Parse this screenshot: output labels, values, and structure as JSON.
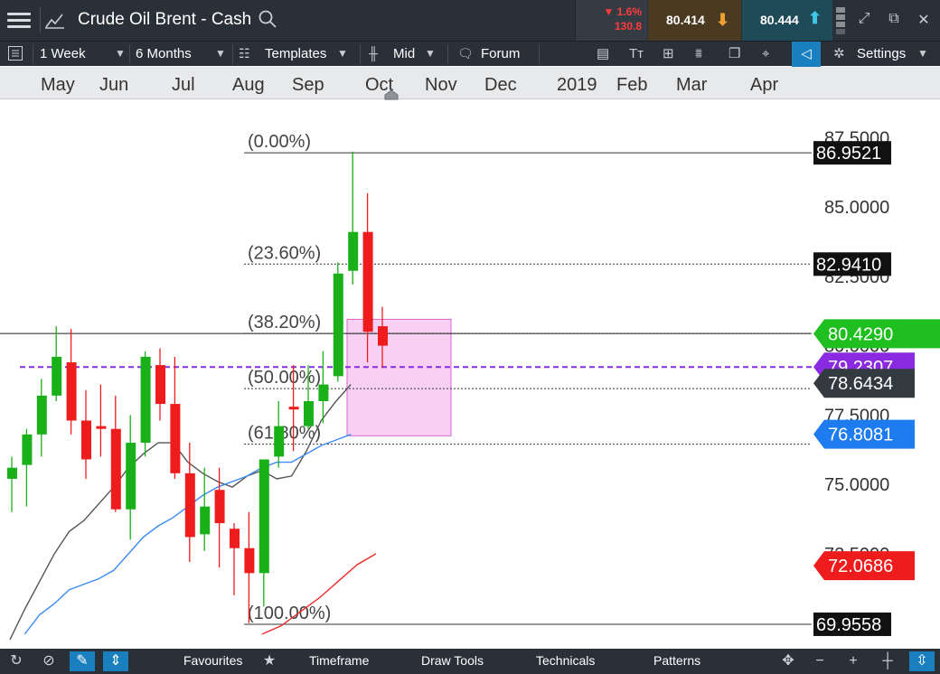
{
  "header": {
    "title": "Crude Oil Brent - Cash",
    "change_pct": "▼ 1.6%",
    "change_pts": "130.8",
    "bid": "80.414",
    "ask": "80.444"
  },
  "toolbar": {
    "interval": "1 Week",
    "range": "6 Months",
    "templates": "Templates",
    "price_type": "Mid",
    "forum": "Forum",
    "settings": "Settings"
  },
  "time_axis": {
    "months": [
      "May",
      "Jun",
      "Jul",
      "Aug",
      "Sep",
      "Oct",
      "Nov",
      "Dec",
      "2019",
      "Feb",
      "Mar",
      "Apr"
    ]
  },
  "bottom_bar": {
    "favourites": "Favourites",
    "timeframe": "Timeframe",
    "draw_tools": "Draw Tools",
    "technicals": "Technicals",
    "patterns": "Patterns"
  },
  "colors": {
    "up": "#19b019",
    "down": "#ee1c1c",
    "ma_short": "#555555",
    "ma_mid": "#3a8cf0",
    "ma_long": "#ee2b2b",
    "fib_box": "#f7c8f2",
    "current_price": "#1fbf1f",
    "dashed_line": "#8a2be2"
  },
  "chart_data": {
    "type": "candlestick",
    "y_ticks": [
      "87.5000",
      "85.0000",
      "82.5000",
      "80.0000",
      "77.5000",
      "75.0000",
      "72.5000"
    ],
    "ylim": [
      69.3,
      88.5
    ],
    "fib_levels": [
      {
        "label": "(0.00%)",
        "value": 86.9521,
        "tag": "86.9521"
      },
      {
        "label": "(23.60%)",
        "value": 82.941,
        "tag": "82.9410"
      },
      {
        "label": "(38.20%)",
        "value": 80.44,
        "tag": ""
      },
      {
        "label": "(50.00%)",
        "value": 78.45,
        "tag": ""
      },
      {
        "label": "(61.80%)",
        "value": 76.45,
        "tag": ""
      },
      {
        "label": "(100.00%)",
        "value": 69.9558,
        "tag": "69.9558"
      }
    ],
    "price_tags": [
      {
        "value": 80.429,
        "text": "80.4290",
        "color": "#1fbf1f"
      },
      {
        "value": 79.2307,
        "text": "79.2307",
        "color": "#8a2be2"
      },
      {
        "value": 78.6434,
        "text": "78.6434",
        "color": "#333a40"
      },
      {
        "value": 76.8081,
        "text": "76.8081",
        "color": "#1e7cf0"
      },
      {
        "value": 72.0686,
        "text": "72.0686",
        "color": "#ee1c1c"
      }
    ],
    "candles": [
      {
        "o": 75.2,
        "h": 76.0,
        "l": 74.0,
        "c": 75.6
      },
      {
        "o": 75.7,
        "h": 77.0,
        "l": 74.2,
        "c": 76.8
      },
      {
        "o": 76.8,
        "h": 78.8,
        "l": 76.0,
        "c": 78.2
      },
      {
        "o": 78.2,
        "h": 80.7,
        "l": 78.0,
        "c": 79.6
      },
      {
        "o": 79.4,
        "h": 80.6,
        "l": 76.8,
        "c": 77.3
      },
      {
        "o": 77.3,
        "h": 78.4,
        "l": 75.2,
        "c": 75.9
      },
      {
        "o": 77.1,
        "h": 78.6,
        "l": 76.0,
        "c": 77.0
      },
      {
        "o": 77.0,
        "h": 78.2,
        "l": 74.0,
        "c": 74.1
      },
      {
        "o": 74.1,
        "h": 77.5,
        "l": 73.0,
        "c": 76.5
      },
      {
        "o": 76.5,
        "h": 79.8,
        "l": 76.0,
        "c": 79.6
      },
      {
        "o": 79.3,
        "h": 79.9,
        "l": 77.3,
        "c": 77.9
      },
      {
        "o": 77.9,
        "h": 79.6,
        "l": 75.2,
        "c": 75.4
      },
      {
        "o": 75.4,
        "h": 76.5,
        "l": 72.2,
        "c": 73.1
      },
      {
        "o": 73.2,
        "h": 75.6,
        "l": 72.6,
        "c": 74.2
      },
      {
        "o": 74.8,
        "h": 75.6,
        "l": 72.0,
        "c": 73.6
      },
      {
        "o": 73.4,
        "h": 73.6,
        "l": 71.0,
        "c": 72.7
      },
      {
        "o": 72.7,
        "h": 74.0,
        "l": 70.0,
        "c": 71.8
      },
      {
        "o": 71.8,
        "h": 75.9,
        "l": 70.6,
        "c": 75.9
      },
      {
        "o": 76.0,
        "h": 78.0,
        "l": 75.6,
        "c": 77.1
      },
      {
        "o": 77.8,
        "h": 79.3,
        "l": 76.2,
        "c": 77.7
      },
      {
        "o": 77.1,
        "h": 79.3,
        "l": 77.0,
        "c": 78.0
      },
      {
        "o": 78.0,
        "h": 79.8,
        "l": 77.2,
        "c": 78.6
      },
      {
        "o": 78.9,
        "h": 83.0,
        "l": 78.7,
        "c": 82.6
      },
      {
        "o": 82.7,
        "h": 87.0,
        "l": 82.2,
        "c": 84.1
      },
      {
        "o": 84.1,
        "h": 85.5,
        "l": 79.4,
        "c": 80.5
      },
      {
        "o": 80.7,
        "h": 81.4,
        "l": 79.2,
        "c": 80.0
      }
    ],
    "ma_short": [
      69.4,
      70.5,
      71.5,
      72.5,
      73.3,
      73.7,
      74.3,
      74.9,
      75.6,
      76.1,
      76.5,
      76.5,
      75.8,
      75.4,
      75.1,
      74.9,
      75.3,
      75.5,
      75.2,
      75.3,
      76.2,
      77.3,
      78.0,
      78.6
    ],
    "ma_mid": [
      69.6,
      70.3,
      70.7,
      71.2,
      71.4,
      71.6,
      71.9,
      72.5,
      73.1,
      73.5,
      73.8,
      74.2,
      74.6,
      74.9,
      75.1,
      75.3,
      75.6,
      75.8,
      75.8,
      76.1,
      76.4,
      76.6,
      76.8
    ],
    "ma_long": [
      69.6,
      69.9,
      70.4,
      70.9,
      71.5,
      72.1,
      72.5
    ]
  }
}
